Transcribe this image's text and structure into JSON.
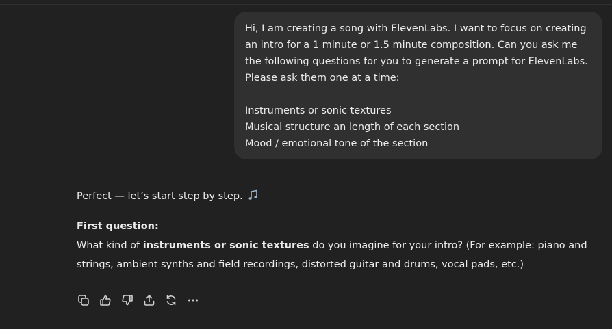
{
  "user_message": {
    "paragraph1": "Hi, I am creating a song with ElevenLabs. I want to focus on creating an intro for a 1 minute or 1.5 minute composition. Can you ask me the following questions for you to generate a prompt for ElevenLabs. Please ask them one at a time:",
    "items": [
      "Instruments or sonic textures",
      "Musical structure an length of each section",
      "Mood / emotional tone of the section"
    ]
  },
  "assistant_message": {
    "intro": "Perfect — let’s start step by step.",
    "intro_emoji": "music-note-icon",
    "question_title": "First question:",
    "question_before": "What kind of ",
    "question_bold": "instruments or sonic textures",
    "question_after": " do you imagine for your intro? (For example: piano and strings, ambient synths and field recordings, distorted guitar and drums, vocal pads, etc.)"
  },
  "actions": [
    "copy-icon",
    "thumbs-up-icon",
    "thumbs-down-icon",
    "share-icon",
    "regenerate-icon",
    "more-icon"
  ]
}
